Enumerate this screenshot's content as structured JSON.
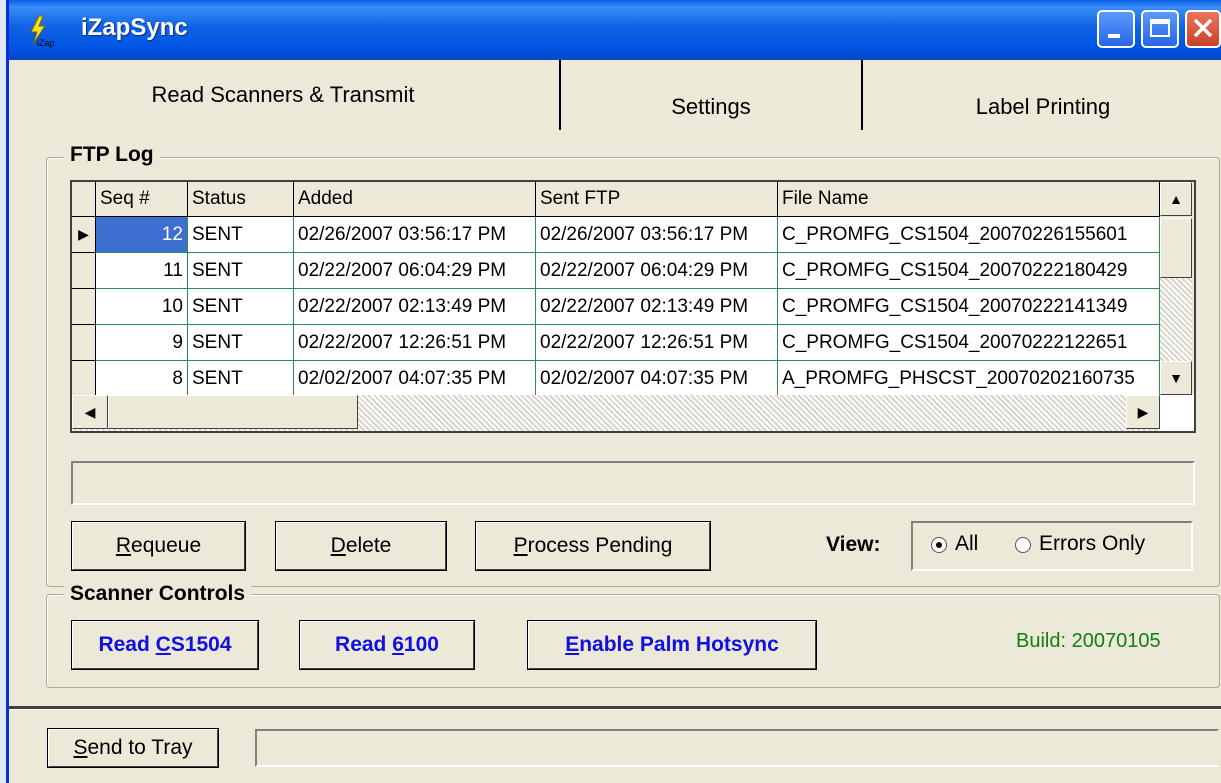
{
  "window": {
    "title": "iZapSync",
    "app_icon_text": "iZap"
  },
  "tabs": [
    {
      "label": "Read Scanners & Transmit",
      "active": true
    },
    {
      "label": "Settings",
      "active": false
    },
    {
      "label": "Label Printing",
      "active": false
    }
  ],
  "ftp_log": {
    "label": "FTP Log",
    "columns": [
      "Seq #",
      "Status",
      "Added",
      "Sent FTP",
      "File Name"
    ],
    "rows": [
      {
        "seq": "12",
        "status": "SENT",
        "added": "02/26/2007 03:56:17 PM",
        "sent": "02/26/2007 03:56:17 PM",
        "file": "C_PROMFG_CS1504_20070226155601",
        "selected": true
      },
      {
        "seq": "11",
        "status": "SENT",
        "added": "02/22/2007 06:04:29 PM",
        "sent": "02/22/2007 06:04:29 PM",
        "file": "C_PROMFG_CS1504_20070222180429"
      },
      {
        "seq": "10",
        "status": "SENT",
        "added": "02/22/2007 02:13:49 PM",
        "sent": "02/22/2007 02:13:49 PM",
        "file": "C_PROMFG_CS1504_20070222141349"
      },
      {
        "seq": "9",
        "status": "SENT",
        "added": "02/22/2007 12:26:51 PM",
        "sent": "02/22/2007 12:26:51 PM",
        "file": "C_PROMFG_CS1504_20070222122651"
      },
      {
        "seq": "8",
        "status": "SENT",
        "added": "02/02/2007 04:07:35 PM",
        "sent": "02/02/2007 04:07:35 PM",
        "file": "A_PROMFG_PHSCST_20070202160735"
      }
    ]
  },
  "actions": {
    "requeue": {
      "u": "R",
      "rest": "equeue"
    },
    "delete": {
      "u": "D",
      "rest": "elete"
    },
    "process_pending": {
      "u": "P",
      "rest": "rocess Pending"
    }
  },
  "view": {
    "label": "View:",
    "options": [
      {
        "label": "All",
        "selected": true
      },
      {
        "label": "Errors Only",
        "selected": false
      }
    ]
  },
  "scanner_controls": {
    "label": "Scanner Controls",
    "read_cs1504": {
      "pre": "Read ",
      "u": "C",
      "post": "S1504"
    },
    "read_6100": {
      "pre": "Read ",
      "u": "6",
      "post": "100"
    },
    "enable_palm": {
      "pre": "",
      "u": "E",
      "post": "nable Palm Hotsync"
    },
    "build": "Build: 20070105"
  },
  "footer": {
    "send_to_tray": {
      "u": "S",
      "rest": "end to Tray"
    }
  },
  "colors": {
    "title_bar": "#0054e3",
    "selection": "#3c6fd0",
    "grid_lines": "#2e8b57",
    "scanner_button_text": "#1010e0",
    "build_text": "#108010"
  }
}
